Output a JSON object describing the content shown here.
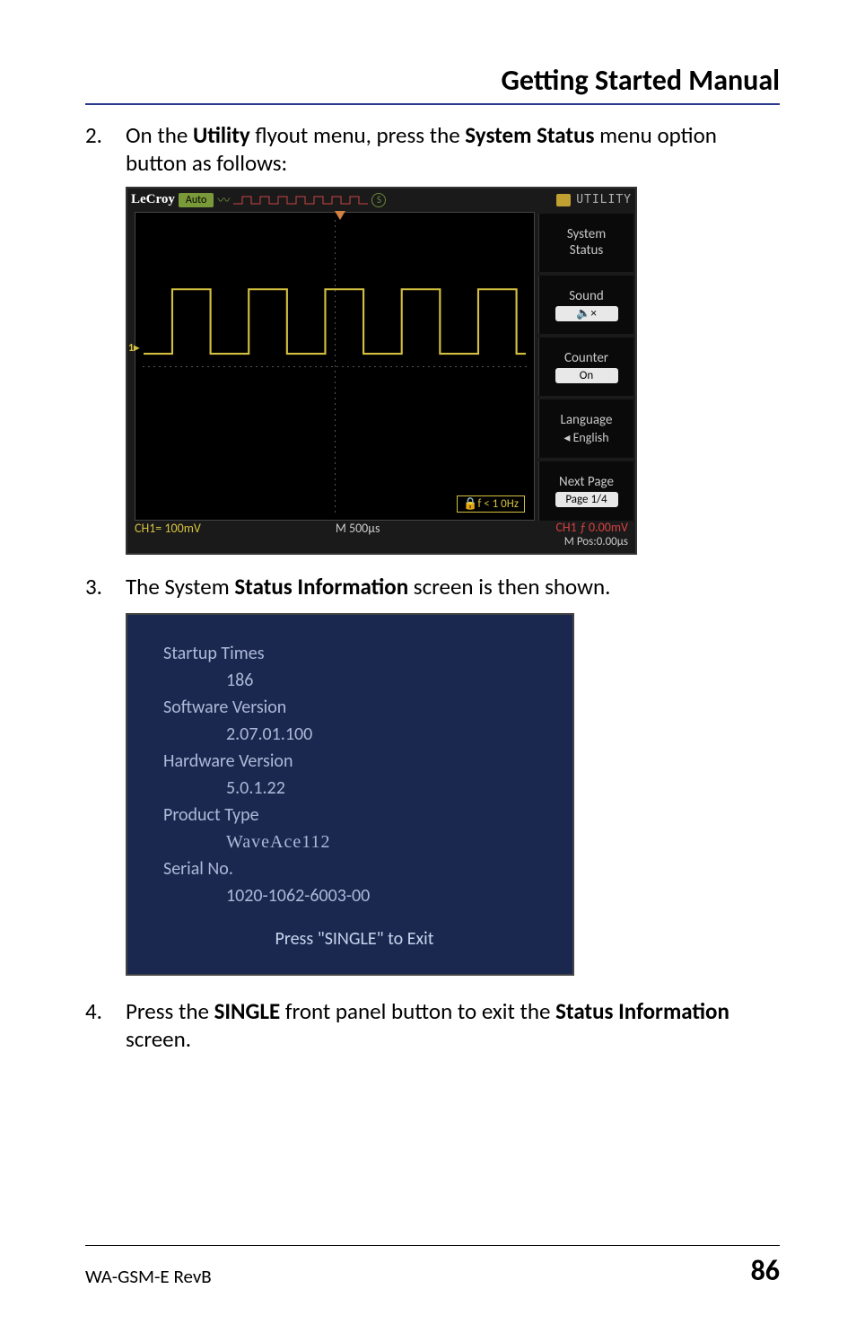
{
  "header": {
    "title": "Getting Started Manual"
  },
  "steps": {
    "s2": {
      "num": "2.",
      "pre": "On the ",
      "bold1": "Utility",
      "mid": " flyout menu, press the ",
      "bold2": "System Status",
      "post": " menu option button as follows:"
    },
    "s3": {
      "num": "3.",
      "pre": "The System ",
      "bold1": "Status Information",
      "post": " screen is then shown."
    },
    "s4": {
      "num": "4.",
      "pre": "Press the ",
      "bold1": "SINGLE",
      "mid": " front panel button to exit the ",
      "bold2": "Status Information",
      "post": " screen."
    }
  },
  "scope": {
    "brand": "LeCroy",
    "auto": "Auto",
    "utility": "UTILITY",
    "menu": {
      "system_status": "System\nStatus",
      "sound": "Sound",
      "sound_icon": "🔈×",
      "counter": "Counter",
      "counter_val": "On",
      "language": "Language",
      "language_val": "English",
      "nextpage": "Next Page",
      "nextpage_val": "Page 1/4"
    },
    "freq": "f < 1 0Hz",
    "ch1_scale": "CH1= 100mV",
    "timebase": "M 500µs",
    "ch1_trig": "CH1 ƒ 0.00mV",
    "mpos": "M Pos:0.00µs",
    "ch1_marker": "1▸"
  },
  "status": {
    "startup_label": "Startup Times",
    "startup_val": "186",
    "sw_label": "Software Version",
    "sw_val": "2.07.01.100",
    "hw_label": "Hardware Version",
    "hw_val": "5.0.1.22",
    "product_label": "Product Type",
    "product_val": "WaveAce112",
    "serial_label": "Serial No.",
    "serial_val": "1020-1062-6003-00",
    "exit": "Press \"SINGLE\" to Exit"
  },
  "footer": {
    "left": "WA-GSM-E RevB",
    "right": "86"
  }
}
